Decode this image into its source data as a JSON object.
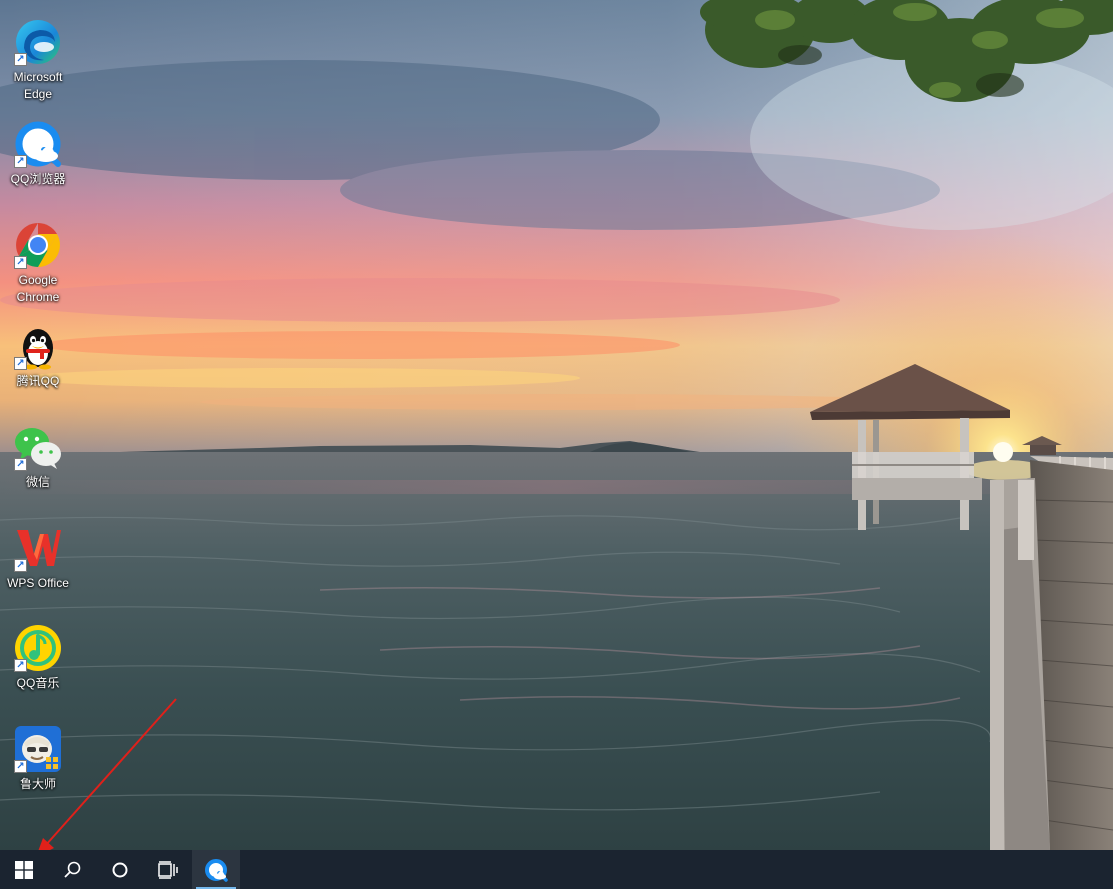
{
  "desktop": {
    "icons": [
      {
        "label": "Microsoft Edge",
        "icon": "edge-icon"
      },
      {
        "label": "QQ浏览器",
        "icon": "qq-browser-icon"
      },
      {
        "label": "Google Chrome",
        "icon": "chrome-icon"
      },
      {
        "label": "腾讯QQ",
        "icon": "qq-penguin-icon"
      },
      {
        "label": "微信",
        "icon": "wechat-icon"
      },
      {
        "label": "WPS Office",
        "icon": "wps-icon"
      },
      {
        "label": "QQ音乐",
        "icon": "qq-music-icon"
      },
      {
        "label": "鲁大师",
        "icon": "ludashi-icon"
      }
    ],
    "annotation": {
      "type": "arrow",
      "color": "#e0201a",
      "points_to": "start-button"
    }
  },
  "taskbar": {
    "buttons": [
      {
        "name": "start",
        "icon": "windows-logo-icon"
      },
      {
        "name": "search",
        "icon": "search-icon"
      },
      {
        "name": "cortana",
        "icon": "circle-icon"
      },
      {
        "name": "task-view",
        "icon": "task-view-icon"
      },
      {
        "name": "qq-browser",
        "icon": "qq-browser-icon",
        "running": true
      }
    ],
    "background": "#1b2430",
    "accent": "#76b9ed"
  }
}
